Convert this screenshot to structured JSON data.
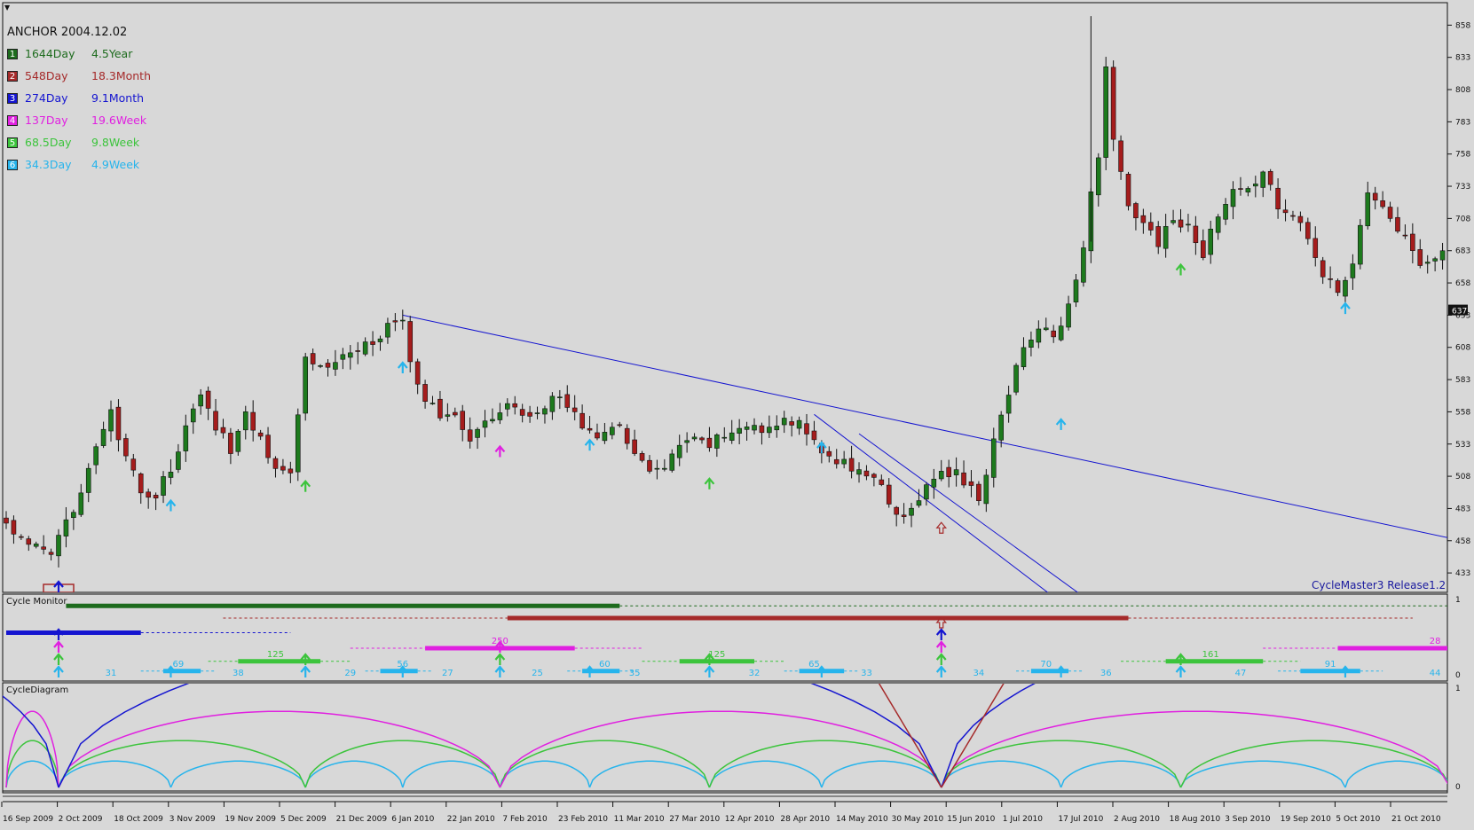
{
  "header": {
    "anchor_label": "ANCHOR 2004.12.02",
    "cycles": [
      {
        "index": "1",
        "days": "1644Day",
        "span": "4.5Year",
        "color": "#1d6b1d"
      },
      {
        "index": "2",
        "days": "548Day",
        "span": "18.3Month",
        "color": "#a52a2a"
      },
      {
        "index": "3",
        "days": "274Day",
        "span": "9.1Month",
        "color": "#1515d0"
      },
      {
        "index": "4",
        "days": "137Day",
        "span": "19.6Week",
        "color": "#e020e0"
      },
      {
        "index": "5",
        "days": "68.5Day",
        "span": "9.8Week",
        "color": "#3cc43c"
      },
      {
        "index": "6",
        "days": "34.3Day",
        "span": "4.9Week",
        "color": "#26b4ec"
      }
    ],
    "release": "CycleMaster3 Release1.2"
  },
  "panels": {
    "monitor_title": "Cycle Monitor",
    "diagram_title": "CycleDiagram",
    "scale_top": "1",
    "scale_bottom": "0"
  },
  "chart_data": {
    "type": "candlestick",
    "y_ticks": [
      "858",
      "833",
      "808",
      "783",
      "758",
      "733",
      "708",
      "683",
      "658",
      "633",
      "608",
      "583",
      "558",
      "533",
      "508",
      "483",
      "458",
      "433"
    ],
    "ylim": [
      420,
      872
    ],
    "current_price": "637",
    "x_labels": [
      "16 Sep 2009",
      "2 Oct 2009",
      "18 Oct 2009",
      "3 Nov 2009",
      "19 Nov 2009",
      "5 Dec 2009",
      "21 Dec 2009",
      "6 Jan 2010",
      "22 Jan 2010",
      "7 Feb 2010",
      "23 Feb 2010",
      "11 Mar 2010",
      "27 Mar 2010",
      "12 Apr 2010",
      "28 Apr 2010",
      "14 May 2010",
      "30 May 2010",
      "15 Jun 2010",
      "1 Jul 2010",
      "17 Jul 2010",
      "2 Aug 2010",
      "18 Aug 2010",
      "3 Sep 2010",
      "19 Sep 2010",
      "5 Oct 2010",
      "21 Oct 2010"
    ],
    "price_path": [
      [
        0,
        470
      ],
      [
        2,
        462
      ],
      [
        4,
        452
      ],
      [
        6,
        445
      ],
      [
        8,
        470
      ],
      [
        10,
        500
      ],
      [
        12,
        532
      ],
      [
        14,
        555
      ],
      [
        16,
        520
      ],
      [
        18,
        497
      ],
      [
        20,
        492
      ],
      [
        22,
        515
      ],
      [
        24,
        545
      ],
      [
        26,
        568
      ],
      [
        28,
        548
      ],
      [
        30,
        530
      ],
      [
        32,
        555
      ],
      [
        34,
        540
      ],
      [
        36,
        512
      ],
      [
        38,
        515
      ],
      [
        40,
        605
      ],
      [
        42,
        592
      ],
      [
        44,
        598
      ],
      [
        46,
        605
      ],
      [
        48,
        610
      ],
      [
        50,
        618
      ],
      [
        52,
        628
      ],
      [
        53,
        625
      ],
      [
        54,
        595
      ],
      [
        56,
        568
      ],
      [
        58,
        555
      ],
      [
        60,
        552
      ],
      [
        62,
        540
      ],
      [
        64,
        548
      ],
      [
        66,
        560
      ],
      [
        68,
        562
      ],
      [
        70,
        555
      ],
      [
        72,
        565
      ],
      [
        74,
        568
      ],
      [
        76,
        555
      ],
      [
        78,
        545
      ],
      [
        80,
        538
      ],
      [
        82,
        545
      ],
      [
        84,
        528
      ],
      [
        86,
        512
      ],
      [
        88,
        512
      ],
      [
        90,
        530
      ],
      [
        92,
        535
      ],
      [
        94,
        532
      ],
      [
        96,
        540
      ],
      [
        98,
        548
      ],
      [
        100,
        545
      ],
      [
        102,
        542
      ],
      [
        104,
        552
      ],
      [
        106,
        550
      ],
      [
        108,
        540
      ],
      [
        110,
        520
      ],
      [
        112,
        517
      ],
      [
        114,
        515
      ],
      [
        116,
        505
      ],
      [
        118,
        488
      ],
      [
        120,
        475
      ],
      [
        122,
        492
      ],
      [
        124,
        505
      ],
      [
        126,
        512
      ],
      [
        128,
        505
      ],
      [
        130,
        490
      ],
      [
        132,
        535
      ],
      [
        134,
        575
      ],
      [
        136,
        605
      ],
      [
        138,
        625
      ],
      [
        140,
        615
      ],
      [
        142,
        640
      ],
      [
        144,
        690
      ],
      [
        146,
        760
      ],
      [
        147,
        828
      ],
      [
        148,
        765
      ],
      [
        150,
        715
      ],
      [
        152,
        705
      ],
      [
        154,
        690
      ],
      [
        156,
        705
      ],
      [
        158,
        700
      ],
      [
        160,
        680
      ],
      [
        162,
        710
      ],
      [
        164,
        735
      ],
      [
        166,
        730
      ],
      [
        168,
        740
      ],
      [
        170,
        720
      ],
      [
        172,
        710
      ],
      [
        174,
        690
      ],
      [
        176,
        665
      ],
      [
        178,
        655
      ],
      [
        180,
        668
      ],
      [
        182,
        730
      ],
      [
        184,
        715
      ],
      [
        186,
        700
      ],
      [
        188,
        680
      ],
      [
        190,
        670
      ],
      [
        192,
        685
      ],
      [
        193,
        705
      ]
    ],
    "spikes": [
      [
        145,
        865,
        690
      ]
    ],
    "trendlines": [
      {
        "from": [
          53,
          633
        ],
        "to": [
          193,
          460
        ],
        "color": "#1515d0"
      },
      {
        "from": [
          108,
          556
        ],
        "to": [
          141,
          410
        ],
        "color": "#1515d0"
      },
      {
        "from": [
          114,
          541
        ],
        "to": [
          147,
          402
        ],
        "color": "#1515d0"
      }
    ],
    "price_arrows": [
      {
        "bar": 22,
        "price": 485,
        "color": "#26b4ec"
      },
      {
        "bar": 40,
        "price": 500,
        "color": "#3cc43c"
      },
      {
        "bar": 53,
        "price": 592,
        "color": "#26b4ec"
      },
      {
        "bar": 66,
        "price": 527,
        "color": "#e020e0"
      },
      {
        "bar": 78,
        "price": 532,
        "color": "#26b4ec"
      },
      {
        "bar": 94,
        "price": 502,
        "color": "#3cc43c"
      },
      {
        "bar": 109,
        "price": 530,
        "color": "#26b4ec"
      },
      {
        "bar": 125,
        "price": 468,
        "color": "#a52a2a"
      },
      {
        "bar": 141,
        "price": 548,
        "color": "#26b4ec"
      },
      {
        "bar": 157,
        "price": 668,
        "color": "#3cc43c"
      },
      {
        "bar": 179,
        "price": 638,
        "color": "#26b4ec"
      }
    ],
    "monitor": {
      "bars": [
        {
          "color": "#1d6b1d",
          "level": 0.9,
          "from": 8,
          "to": 82,
          "dash_to": 193
        },
        {
          "color": "#a52a2a",
          "level": 0.75,
          "from": 67,
          "to": 150,
          "dash_from": 29,
          "dash_to": 188
        },
        {
          "color": "#1515d0",
          "level": 0.57,
          "from": 0,
          "to": 18,
          "dash_to": 38
        },
        {
          "color": "#e020e0",
          "level": 0.38,
          "from": 56,
          "to": 76,
          "dash_from": 46,
          "dash_to": 85,
          "label": "250",
          "label_at": 66
        },
        {
          "color": "#e020e0",
          "level": 0.38,
          "from": 178,
          "to": 193,
          "dash_from": 168,
          "label": "28",
          "label_at": 191
        },
        {
          "color": "#3cc43c",
          "level": 0.22,
          "from": 31,
          "to": 42,
          "dash_from": 27,
          "dash_to": 46,
          "label": "125",
          "label_at": 36
        },
        {
          "color": "#3cc43c",
          "level": 0.22,
          "from": 90,
          "to": 100,
          "dash_from": 85,
          "dash_to": 104,
          "label": "125",
          "label_at": 95
        },
        {
          "color": "#3cc43c",
          "level": 0.22,
          "from": 155,
          "to": 168,
          "dash_from": 149,
          "dash_to": 173,
          "label": "161",
          "label_at": 161
        },
        {
          "color": "#26b4ec",
          "level": 0.1,
          "from": 21,
          "to": 26,
          "dash_from": 18,
          "dash_to": 28,
          "label": "69",
          "label_at": 23
        },
        {
          "color": "#26b4ec",
          "level": 0.1,
          "from": 50,
          "to": 55,
          "dash_from": 48,
          "dash_to": 57,
          "label": "56",
          "label_at": 53
        },
        {
          "color": "#26b4ec",
          "level": 0.1,
          "from": 77,
          "to": 82,
          "dash_from": 75,
          "dash_to": 84,
          "label": "60",
          "label_at": 80
        },
        {
          "color": "#26b4ec",
          "level": 0.1,
          "from": 106,
          "to": 112,
          "dash_from": 104,
          "dash_to": 114,
          "label": "65",
          "label_at": 108
        },
        {
          "color": "#26b4ec",
          "level": 0.1,
          "from": 137,
          "to": 142,
          "dash_from": 135,
          "dash_to": 144,
          "label": "70",
          "label_at": 139
        },
        {
          "color": "#26b4ec",
          "level": 0.1,
          "from": 173,
          "to": 181,
          "dash_from": 170,
          "dash_to": 184,
          "label": "91",
          "label_at": 177
        }
      ],
      "counts": [
        {
          "bar": 14,
          "text": "31"
        },
        {
          "bar": 31,
          "text": "38"
        },
        {
          "bar": 46,
          "text": "29"
        },
        {
          "bar": 59,
          "text": "27"
        },
        {
          "bar": 71,
          "text": "25"
        },
        {
          "bar": 84,
          "text": "35"
        },
        {
          "bar": 100,
          "text": "32"
        },
        {
          "bar": 115,
          "text": "33"
        },
        {
          "bar": 130,
          "text": "34"
        },
        {
          "bar": 147,
          "text": "36"
        },
        {
          "bar": 165,
          "text": "47"
        },
        {
          "bar": 191,
          "text": "44"
        }
      ],
      "arrow_stacks": [
        {
          "bar": 7,
          "colors": [
            "#26b4ec",
            "#3cc43c",
            "#e020e0",
            "#1515d0"
          ]
        },
        {
          "bar": 22,
          "colors": [
            "#26b4ec"
          ]
        },
        {
          "bar": 40,
          "colors": [
            "#26b4ec",
            "#3cc43c"
          ]
        },
        {
          "bar": 53,
          "colors": [
            "#26b4ec"
          ]
        },
        {
          "bar": 66,
          "colors": [
            "#26b4ec",
            "#3cc43c",
            "#e020e0"
          ]
        },
        {
          "bar": 78,
          "colors": [
            "#26b4ec"
          ]
        },
        {
          "bar": 94,
          "colors": [
            "#26b4ec",
            "#3cc43c"
          ]
        },
        {
          "bar": 109,
          "colors": [
            "#26b4ec"
          ]
        },
        {
          "bar": 125,
          "colors": [
            "#26b4ec",
            "#3cc43c",
            "#e020e0",
            "#1515d0",
            "#a52a2a"
          ]
        },
        {
          "bar": 141,
          "colors": [
            "#26b4ec"
          ]
        },
        {
          "bar": 157,
          "colors": [
            "#26b4ec",
            "#3cc43c"
          ]
        },
        {
          "bar": 179,
          "colors": [
            "#26b4ec"
          ]
        }
      ]
    },
    "diagram": {
      "arcs": [
        {
          "color": "#26b4ec",
          "height": 0.27,
          "troughs": [
            0,
            7,
            22,
            40,
            53,
            66,
            78,
            94,
            109,
            125,
            141,
            157,
            179,
            193
          ]
        },
        {
          "color": "#3cc43c",
          "height": 0.48,
          "troughs": [
            0,
            7,
            40,
            66,
            94,
            125,
            157,
            193
          ]
        },
        {
          "color": "#e020e0",
          "height": 0.78,
          "troughs": [
            0,
            7,
            66,
            125,
            193
          ]
        },
        {
          "color": "#1515d0",
          "height": 1.6,
          "troughs": [
            -60,
            7,
            125,
            210
          ]
        },
        {
          "color": "#a52a2a",
          "height": 6,
          "troughs": [
            -400,
            125,
            650
          ]
        }
      ]
    }
  }
}
